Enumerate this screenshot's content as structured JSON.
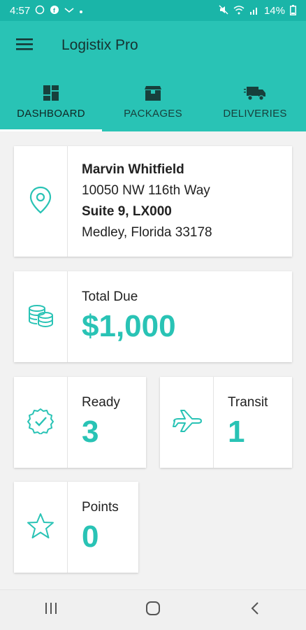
{
  "status_bar": {
    "time": "4:57",
    "battery": "14%"
  },
  "app_bar": {
    "title": "Logistix Pro"
  },
  "tabs": [
    {
      "label": "DASHBOARD",
      "icon": "dashboard-icon",
      "active": true
    },
    {
      "label": "PACKAGES",
      "icon": "package-icon",
      "active": false
    },
    {
      "label": "DELIVERIES",
      "icon": "truck-icon",
      "active": false
    }
  ],
  "address_card": {
    "icon": "location-pin-icon",
    "name": "Marvin Whitfield",
    "street": "10050 NW 116th Way",
    "suite": "Suite 9, LX000",
    "city": "Medley, Florida 33178"
  },
  "total_due_card": {
    "icon": "coins-icon",
    "label": "Total Due",
    "value": "$1,000"
  },
  "ready_card": {
    "icon": "verified-badge-icon",
    "label": "Ready",
    "value": "3"
  },
  "transit_card": {
    "icon": "airplane-icon",
    "label": "Transit",
    "value": "1"
  },
  "points_card": {
    "icon": "star-icon",
    "label": "Points",
    "value": "0"
  },
  "colors": {
    "primary": "#29c3b5",
    "status_bar": "#1ab5a8",
    "accent": "#29c3b5"
  }
}
